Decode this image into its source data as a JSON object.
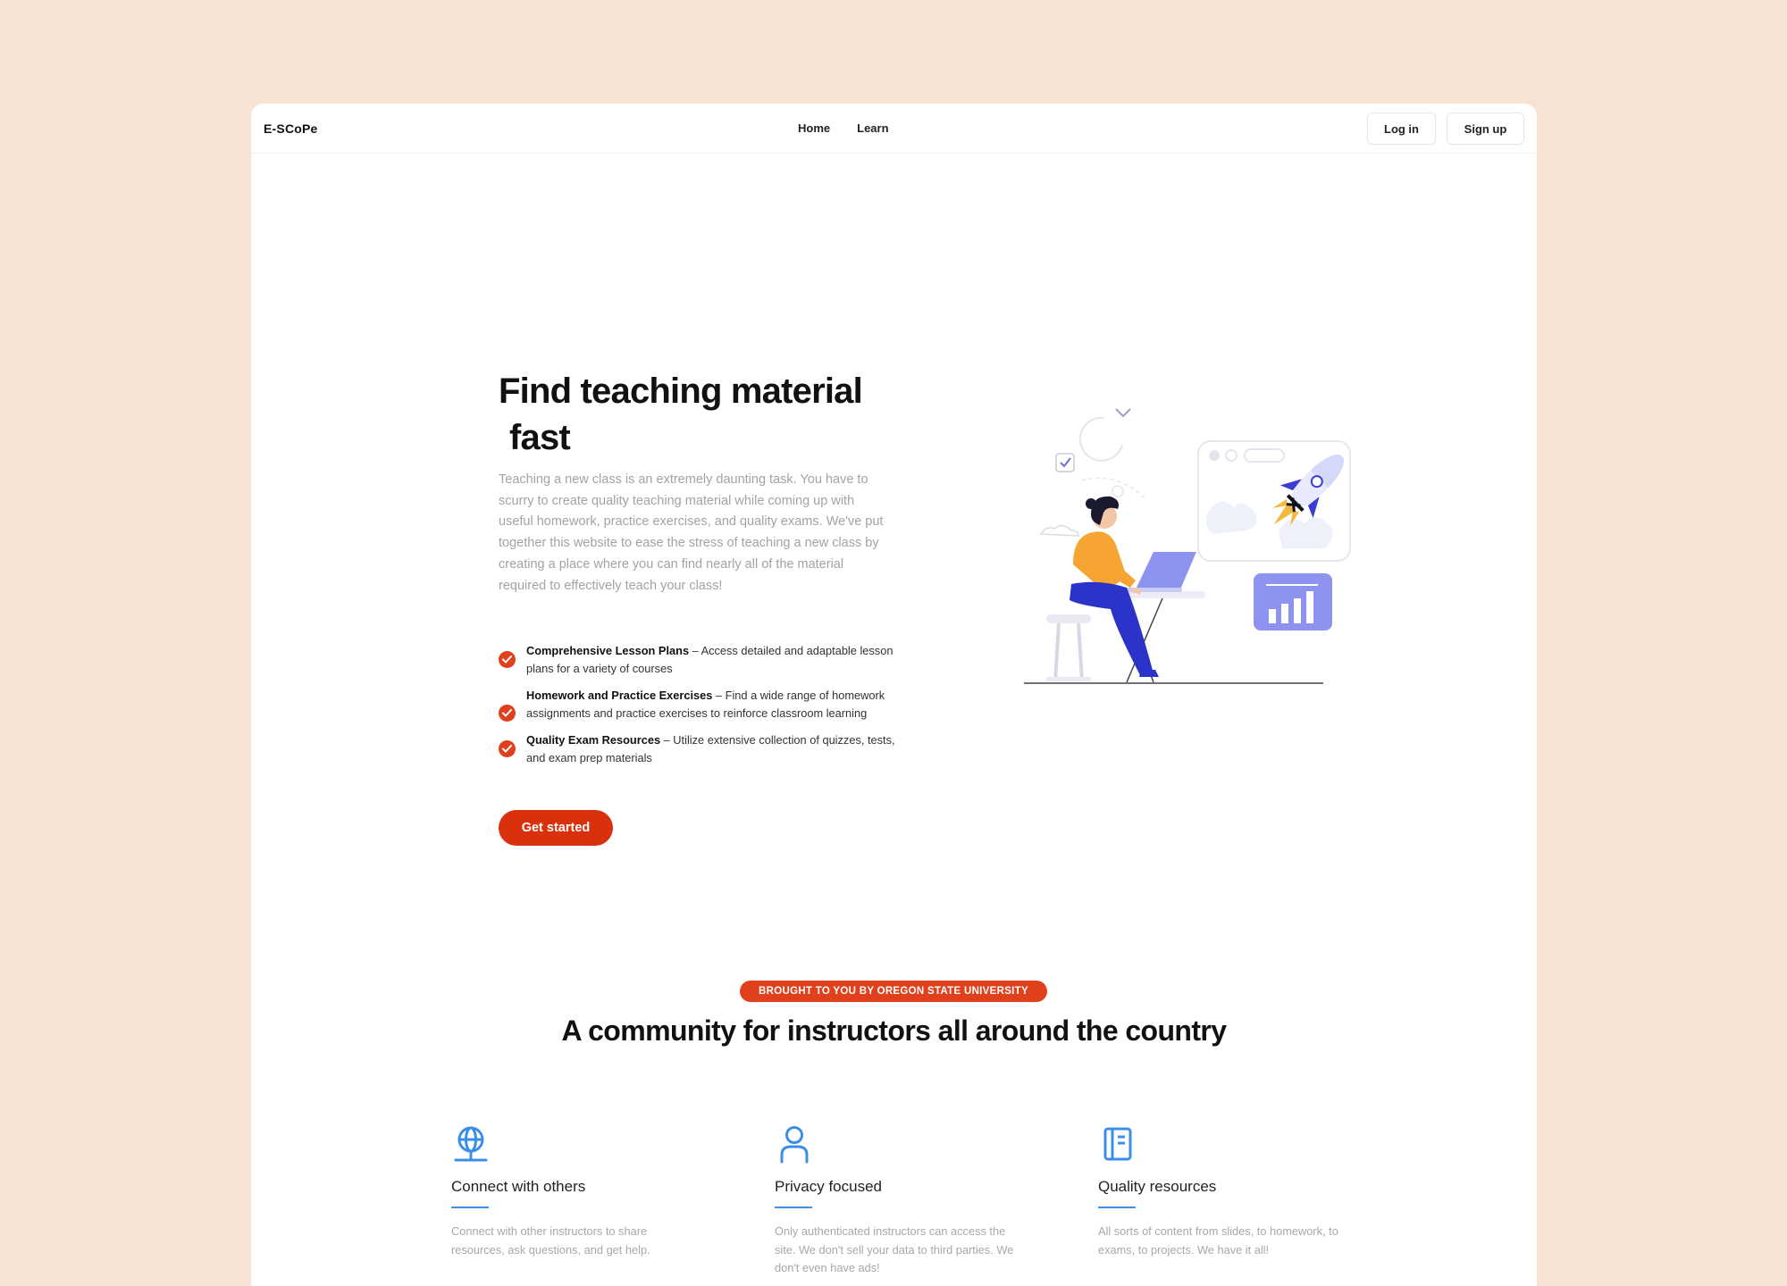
{
  "nav": {
    "brand": "E-SCoPe",
    "links": [
      "Home",
      "Learn"
    ],
    "login_label": "Log in",
    "signup_label": "Sign up"
  },
  "hero": {
    "title_line1": "Find teaching material",
    "title_line2": "fast",
    "description": "Teaching a new class is an extremely daunting task. You have to scurry to create quality teaching material while coming up with useful homework, practice exercises, and quality exams. We've put together this website to ease the stress of teaching a new class by creating a place where you can find nearly all of the material required to effectively teach your class!",
    "features": [
      {
        "title": "Comprehensive Lesson Plans",
        "text": " – Access detailed and adaptable lesson plans for a variety of courses"
      },
      {
        "title": "Homework and Practice Exercises",
        "text": " – Find a wide range of homework assignments and practice exercises to reinforce classroom learning"
      },
      {
        "title": "Quality Exam Resources",
        "text": " – Utilize extensive collection of quizzes, tests, and exam prep materials"
      }
    ],
    "cta_label": "Get started"
  },
  "community": {
    "badge": "BROUGHT TO YOU BY OREGON STATE UNIVERSITY",
    "title": "A community for instructors all around the country",
    "cards": [
      {
        "icon": "globe-icon",
        "title": "Connect with others",
        "text": "Connect with other instructors to share resources, ask questions, and get help."
      },
      {
        "icon": "user-icon",
        "title": "Privacy focused",
        "text": "Only authenticated instructors can access the site. We don't sell your data to third parties. We don't even have ads!"
      },
      {
        "icon": "notebook-icon",
        "title": "Quality resources",
        "text": "All sorts of content from slides, to homework, to exams, to projects. We have it all!"
      }
    ]
  },
  "colors": {
    "background": "#f6e3d3",
    "accent": "#e0401b",
    "icon_blue": "#3b8ee8"
  }
}
